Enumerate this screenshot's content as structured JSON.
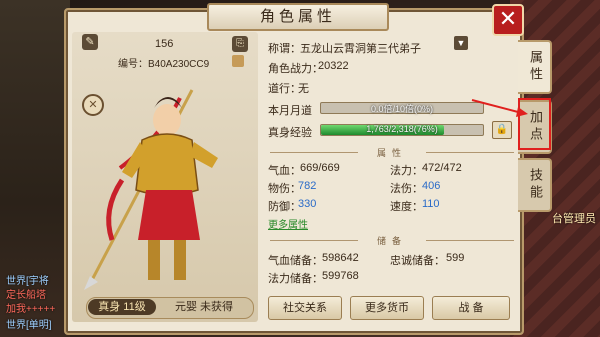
{
  "window": {
    "title": "角色属性",
    "close_label": "✕"
  },
  "chat": {
    "line1": "世界[宇将",
    "line2": "定长船塔",
    "line3": "加我+++++",
    "line4": "世界[单明]"
  },
  "side_text": "台管理员",
  "profile": {
    "number": "156",
    "code": "编号：B40A230CC9",
    "level_label": "真身 11级",
    "yuanying_label": "元婴 未获得"
  },
  "info": {
    "title_label": "称谓：",
    "title_value": "五龙山云霄洞第三代弟子",
    "power_label": "角色战力：",
    "power_value": "20322",
    "daoxing_label": "道行：",
    "daoxing_value": "无",
    "monthly_label": "本月月道",
    "monthly_text": "0.0倍/10倍(0%)",
    "monthly_percent": 0,
    "exp_label": "真身经验",
    "exp_text": "1,763/2,318(76%)",
    "exp_percent": 76
  },
  "attributes": {
    "header": "属性",
    "hp_label": "气血：",
    "hp_value": "669/669",
    "mp_label": "法力：",
    "mp_value": "472/472",
    "phys_label": "物伤：",
    "phys_value": "782",
    "magic_label": "法伤：",
    "magic_value": "406",
    "def_label": "防御：",
    "def_value": "330",
    "speed_label": "速度：",
    "speed_value": "110",
    "more_link": "更多属性"
  },
  "reserve": {
    "header": "储备",
    "hp_label": "气血储备：",
    "hp_value": "598642",
    "loyal_label": "忠诚储备：",
    "loyal_value": "599",
    "mp_label": "法力储备：",
    "mp_value": "599768"
  },
  "buttons": {
    "social": "社交关系",
    "currency": "更多货币",
    "equip": "战 备"
  },
  "tabs": [
    "属性",
    "加点",
    "技能"
  ],
  "colors": {
    "accent_red": "#e0201e",
    "exp_green": "#1e8a2e",
    "stat_blue": "#2a6bc8"
  }
}
